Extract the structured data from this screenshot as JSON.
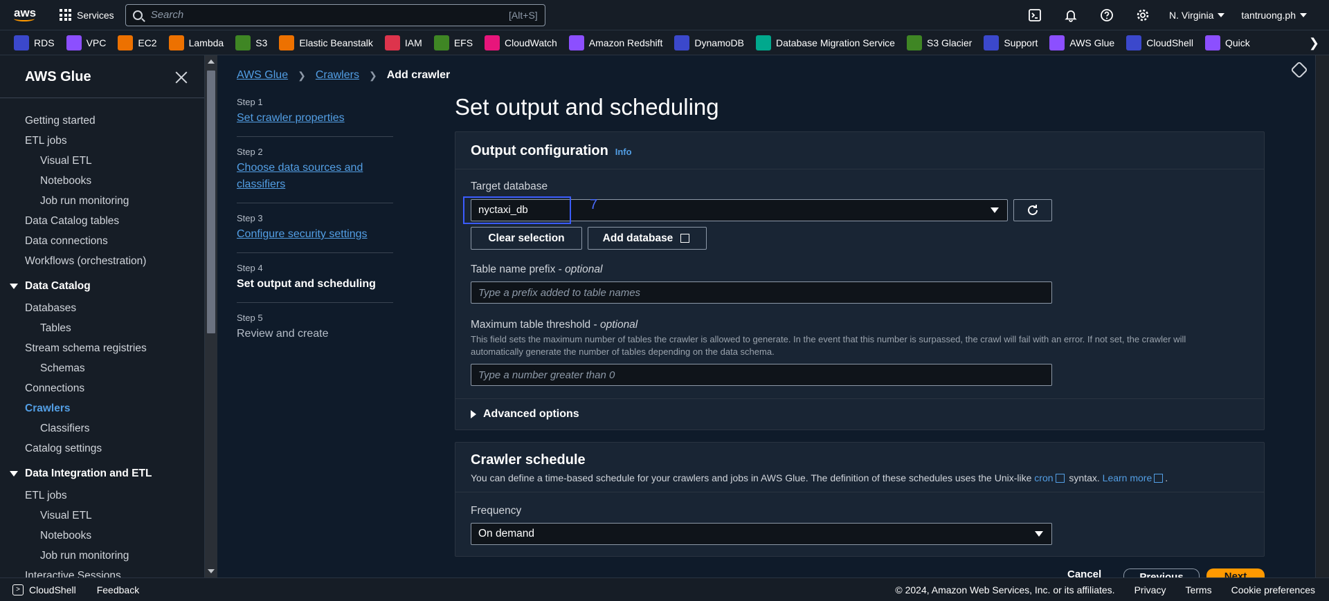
{
  "topnav": {
    "logo": "aws",
    "services_label": "Services",
    "search_placeholder": "Search",
    "search_shortcut": "[Alt+S]",
    "region": "N. Virginia",
    "user": "tantruong.ph",
    "icons": [
      "cloudshell-icon",
      "bell-icon",
      "help-icon",
      "gear-icon"
    ]
  },
  "favorites": [
    {
      "label": "RDS",
      "color": "#3b48cc"
    },
    {
      "label": "VPC",
      "color": "#8c4fff"
    },
    {
      "label": "EC2",
      "color": "#ed7100"
    },
    {
      "label": "Lambda",
      "color": "#ed7100"
    },
    {
      "label": "S3",
      "color": "#3f8624"
    },
    {
      "label": "Elastic Beanstalk",
      "color": "#ed7100"
    },
    {
      "label": "IAM",
      "color": "#dd344c"
    },
    {
      "label": "EFS",
      "color": "#3f8624"
    },
    {
      "label": "CloudWatch",
      "color": "#e7157b"
    },
    {
      "label": "Amazon Redshift",
      "color": "#8c4fff"
    },
    {
      "label": "DynamoDB",
      "color": "#3b48cc"
    },
    {
      "label": "Database Migration Service",
      "color": "#01a88d"
    },
    {
      "label": "S3 Glacier",
      "color": "#3f8624"
    },
    {
      "label": "Support",
      "color": "#3b48cc"
    },
    {
      "label": "AWS Glue",
      "color": "#8c4fff"
    },
    {
      "label": "CloudShell",
      "color": "#3b48cc"
    },
    {
      "label": "Quick",
      "color": "#8c4fff"
    }
  ],
  "sidebar": {
    "title": "AWS Glue",
    "items_top": [
      "Getting started",
      "ETL jobs"
    ],
    "etl_children": [
      "Visual ETL",
      "Notebooks",
      "Job run monitoring"
    ],
    "items_mid": [
      "Data Catalog tables",
      "Data connections",
      "Workflows (orchestration)"
    ],
    "section1": "Data Catalog",
    "databases": "Databases",
    "tables": "Tables",
    "stream": "Stream schema registries",
    "schemas": "Schemas",
    "connections": "Connections",
    "crawlers": "Crawlers",
    "classifiers": "Classifiers",
    "catalog_settings": "Catalog settings",
    "section2": "Data Integration and ETL",
    "etl_jobs": "ETL jobs",
    "visual_etl": "Visual ETL",
    "notebooks": "Notebooks",
    "job_run": "Job run monitoring",
    "interactive": "Interactive Sessions"
  },
  "breadcrumb": {
    "glue": "AWS Glue",
    "crawlers": "Crawlers",
    "current": "Add crawler"
  },
  "steps": [
    {
      "num": "Step 1",
      "label": "Set crawler properties",
      "state": "link"
    },
    {
      "num": "Step 2",
      "label": "Choose data sources and classifiers",
      "state": "link"
    },
    {
      "num": "Step 3",
      "label": "Configure security settings",
      "state": "link"
    },
    {
      "num": "Step 4",
      "label": "Set output and scheduling",
      "state": "current"
    },
    {
      "num": "Step 5",
      "label": "Review and create",
      "state": "plain"
    }
  ],
  "page_title": "Set output and scheduling",
  "output": {
    "title": "Output configuration",
    "info": "Info",
    "target_label": "Target database",
    "target_value": "nyctaxi_db",
    "annotation": "7",
    "clear_btn": "Clear selection",
    "add_db_btn": "Add database",
    "prefix_label": "Table name prefix",
    "optional": "optional",
    "prefix_placeholder": "Type a prefix added to table names",
    "threshold_label": "Maximum table threshold",
    "threshold_help": "This field sets the maximum number of tables the crawler is allowed to generate. In the event that this number is surpassed, the crawl will fail with an error. If not set, the crawler will automatically generate the number of tables depending on the data schema.",
    "threshold_placeholder": "Type a number greater than 0",
    "advanced": "Advanced options"
  },
  "schedule": {
    "title": "Crawler schedule",
    "desc_prefix": "You can define a time-based schedule for your crawlers and jobs in AWS Glue. The definition of these schedules uses the Unix-like",
    "cron": "cron",
    "desc_mid": "syntax.",
    "learn_more": "Learn more",
    "frequency_label": "Frequency",
    "frequency_value": "On demand"
  },
  "bottom": {
    "cancel": "Cancel",
    "previous": "Previous",
    "next": "Next"
  },
  "footer": {
    "cloudshell": "CloudShell",
    "feedback": "Feedback",
    "copyright": "© 2024, Amazon Web Services, Inc. or its affiliates.",
    "privacy": "Privacy",
    "terms": "Terms",
    "cookies": "Cookie preferences"
  }
}
